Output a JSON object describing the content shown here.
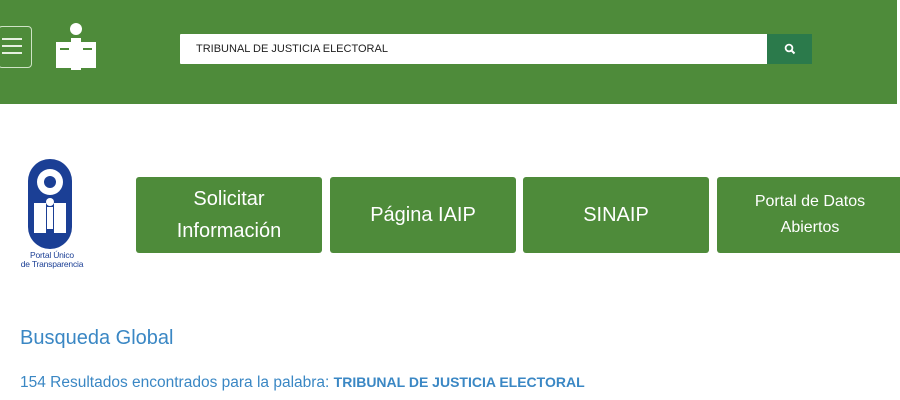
{
  "header": {
    "menu_icon": "hamburger-menu-icon",
    "logo_icon": "people-reading-logo-icon",
    "search": {
      "value": "TRIBUNAL DE JUSTICIA ELECTORAL",
      "button_icon": "search-icon"
    }
  },
  "logo": {
    "line1": "Portal Único",
    "line2": "de Transparencia"
  },
  "nav": {
    "items": [
      {
        "line1": "Solicitar",
        "line2": "Información"
      },
      {
        "label": "Página IAIP"
      },
      {
        "label": "SINAIP"
      },
      {
        "line1": "Portal de Datos",
        "line2": "Abiertos"
      }
    ]
  },
  "main": {
    "title": "Busqueda Global",
    "results_prefix": "154 Resultados encontrados para la palabra: ",
    "results_keyword": "TRIBUNAL DE JUSTICIA ELECTORAL"
  },
  "colors": {
    "header_green": "#4e8b3a",
    "search_button": "#2b7a4b",
    "link_blue": "#3a87c4",
    "logo_blue": "#1b3f95"
  }
}
